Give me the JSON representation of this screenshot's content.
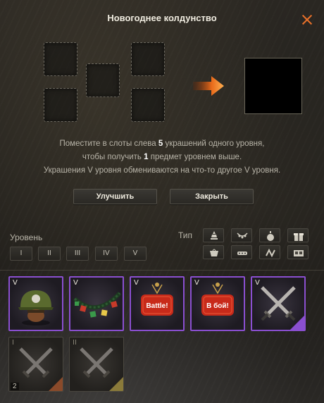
{
  "window": {
    "title": "Новогоднее колдунство"
  },
  "description": {
    "line1_pre": "Поместите в слоты слева ",
    "line1_count": "5",
    "line1_post": " украшений одного уровня,",
    "line2_pre": "чтобы получить ",
    "line2_count": "1",
    "line2_post": " предмет уровнем выше.",
    "line3": "Украшения V уровня обмениваются на что-то другое V уровня."
  },
  "buttons": {
    "upgrade": "Улучшить",
    "close": "Закрыть"
  },
  "filters": {
    "tier_label": "Уровень",
    "tiers": [
      "I",
      "II",
      "III",
      "IV",
      "V"
    ],
    "type_label": "Тип",
    "types": [
      "tree-topper-icon",
      "garland-icon",
      "ball-ornament-icon",
      "gift-icon",
      "hanging-toy-icon",
      "tank-garland-icon",
      "fairy-lights-icon",
      "kitchen-icon"
    ]
  },
  "inventory": [
    {
      "tier": "V",
      "name": "helmet",
      "rarity": "purple"
    },
    {
      "tier": "V",
      "name": "garland",
      "rarity": "purple"
    },
    {
      "tier": "V",
      "name": "battle-sign",
      "sign_text": "Battle!",
      "rarity": "purple"
    },
    {
      "tier": "V",
      "name": "v-boi-sign",
      "sign_text": "В бой!",
      "rarity": "purple"
    },
    {
      "tier": "V",
      "name": "crossed-swords",
      "rarity": "purple"
    },
    {
      "tier": "I",
      "name": "crossed-swords",
      "count": "2",
      "rarity": "gray"
    },
    {
      "tier": "II",
      "name": "crossed-swords",
      "rarity": "gray"
    }
  ],
  "colors": {
    "accent": "#e8702a",
    "purple_border": "#8a4fd0"
  }
}
